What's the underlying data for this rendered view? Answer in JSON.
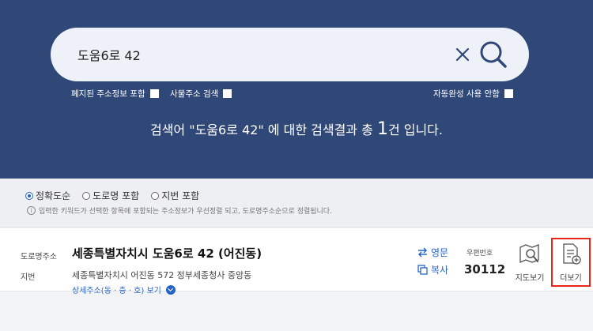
{
  "search": {
    "query": "도움6로 42",
    "options": {
      "abolished": "폐지된 주소정보 포함",
      "object_addr": "사물주소 검색",
      "autocomplete_off": "자동완성 사용 안함"
    },
    "result_prefix": "검색어 \"도움6로 42\" 에 대한 검색결과 총 ",
    "result_count": "1",
    "result_suffix": "건 입니다."
  },
  "filters": {
    "options": [
      "정확도순",
      "도로명 포함",
      "지번 포함"
    ],
    "selected": "정확도순",
    "notice": "입력한 키워드가 선택한 항목에 포함되는 주소정보가 우선정렬 되고, 도로명주소순으로 정렬됩니다."
  },
  "result": {
    "road_label": "도로명주소",
    "road_address": "세종특별자치시 도움6로 42 (어진동)",
    "jibun_label": "지번",
    "jibun_address": "세종특별자치시 어진동 572 정부세종청사 중앙동",
    "detail_link": "상세주소(동 · 층 · 호) 보기",
    "english_label": "영문",
    "copy_label": "복사",
    "zip_label": "우편번호",
    "zip_code": "30112",
    "map_label": "지도보기",
    "more_label": "더보기"
  },
  "colors": {
    "hero_bg": "#2f4878",
    "accent": "#2563c9",
    "highlight": "#e8261c"
  }
}
